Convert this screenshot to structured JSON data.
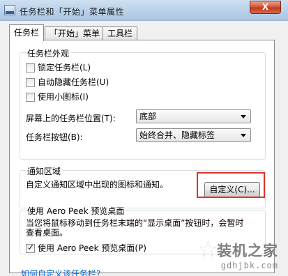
{
  "window": {
    "title": "任务栏和「开始」菜单属性",
    "close_glyph": "X"
  },
  "tabs": [
    {
      "label": "任务栏",
      "active": true
    },
    {
      "label": "「开始」菜单",
      "active": false
    },
    {
      "label": "工具栏",
      "active": false
    }
  ],
  "appearance": {
    "title": "任务栏外观",
    "lock_label": "锁定任务栏(L)",
    "lock_checked": false,
    "autohide_label": "自动隐藏任务栏(U)",
    "autohide_checked": false,
    "small_icons_label": "使用小图标(I)",
    "small_icons_checked": false,
    "position_label": "屏幕上的任务栏位置(T):",
    "position_value": "底部",
    "buttons_label": "任务栏按钮(B):",
    "buttons_value": "始终合并、隐藏标签"
  },
  "notification": {
    "title": "通知区域",
    "description": "自定义通知区域中出现的图标和通知。",
    "customize_label": "自定义(C)..."
  },
  "aero_peek": {
    "title": "使用 Aero Peek 预览桌面",
    "description_line1": "当您将鼠标移动到任务栏末端的“显示桌面”按钮时，会暂时",
    "description_line2": "查看桌面。",
    "checkbox_label": "使用 Aero Peek 预览桌面(P)",
    "checked": true
  },
  "help_link": "如何自定义该任务栏?",
  "watermark": {
    "title": "装机之家",
    "url": "gdhjbk.com"
  },
  "colors": {
    "highlight": "#d8352a",
    "link": "#0066cc"
  }
}
